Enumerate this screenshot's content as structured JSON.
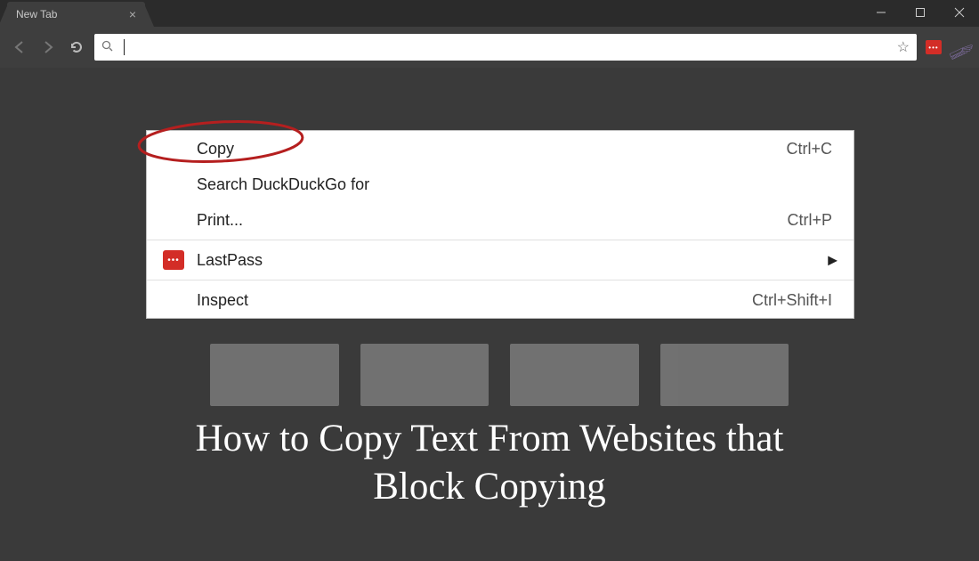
{
  "browser": {
    "tab_title": "New Tab",
    "omnibox_value": "",
    "omnibox_placeholder": ""
  },
  "toolbar_extensions": {
    "lastpass": "LastPass",
    "feather": "Feather"
  },
  "context_menu": {
    "items": [
      {
        "label": "Copy",
        "shortcut": "Ctrl+C"
      },
      {
        "label": "Search DuckDuckGo for",
        "shortcut": ""
      },
      {
        "label": "Print...",
        "shortcut": "Ctrl+P"
      }
    ],
    "lastpass_label": "LastPass",
    "inspect": {
      "label": "Inspect",
      "shortcut": "Ctrl+Shift+I"
    }
  },
  "headline": "How to Copy Text From Websites that Block Copying"
}
